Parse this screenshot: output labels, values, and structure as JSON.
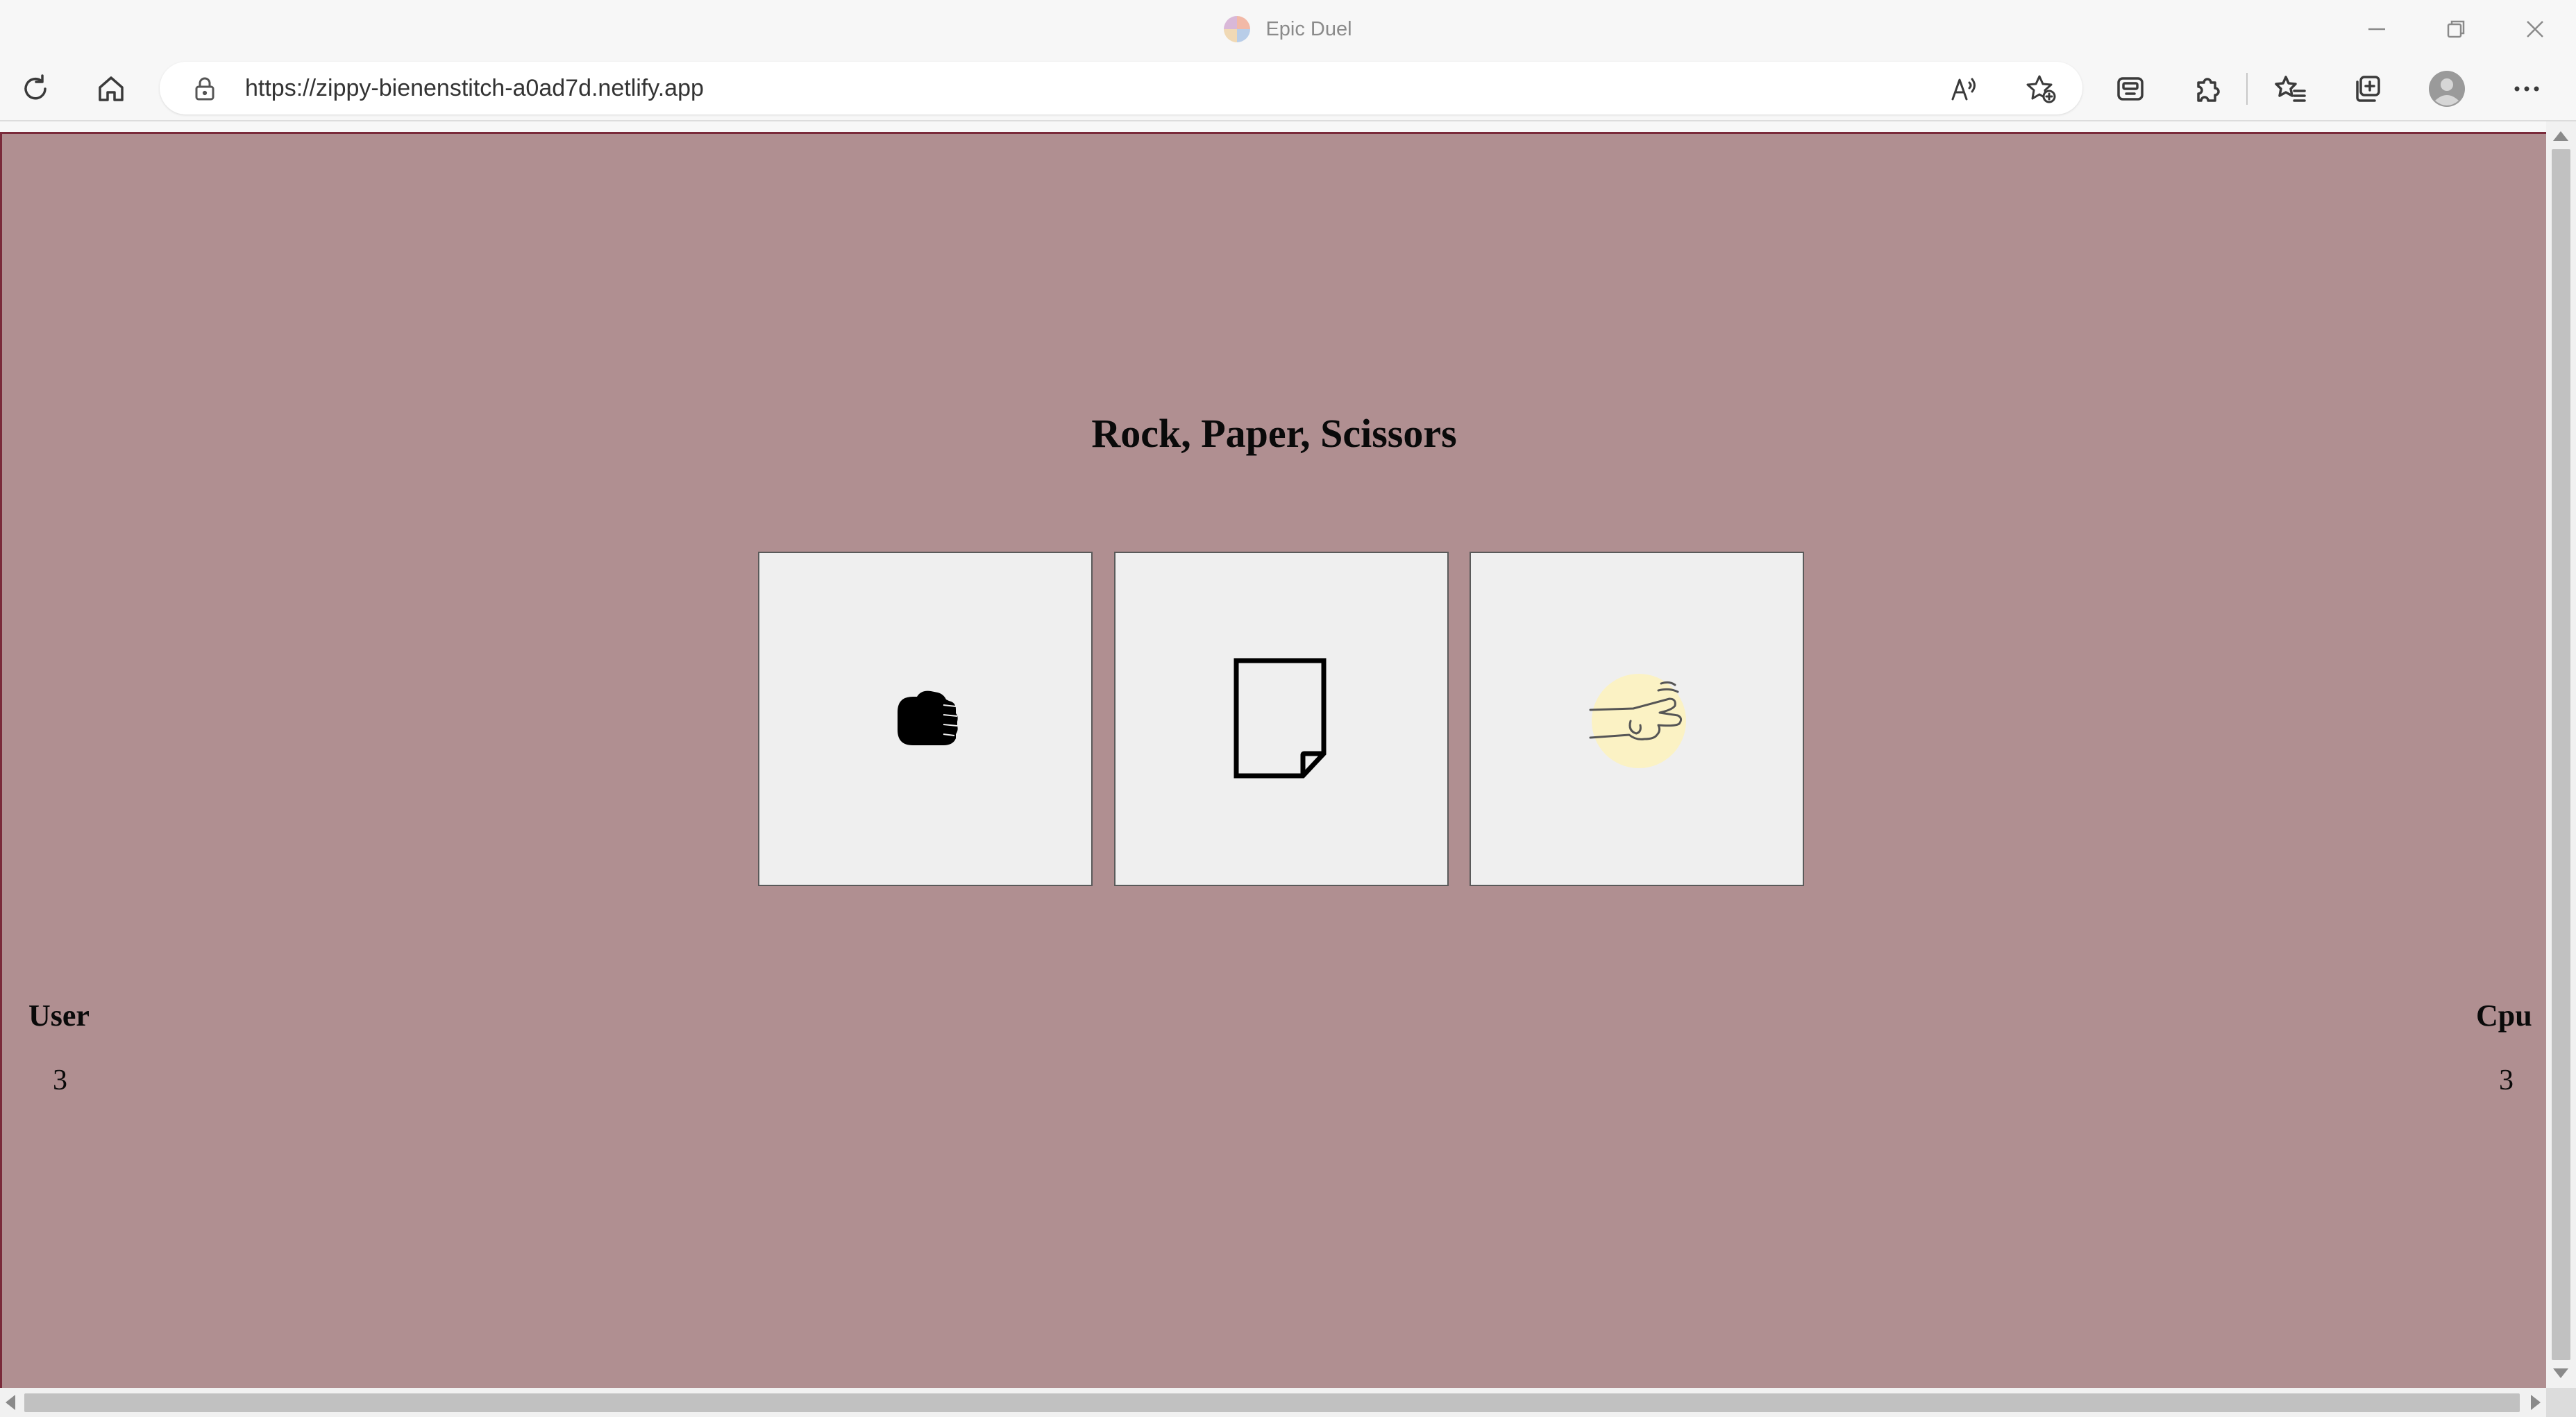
{
  "window": {
    "title": "Epic Duel",
    "controls": [
      "minimize-icon",
      "restore-icon",
      "close-icon"
    ]
  },
  "toolbar": {
    "url": "https://zippy-bienenstitch-a0ad7d.netlify.app",
    "icons": [
      "refresh-icon",
      "home-icon",
      "lock-icon",
      "read-aloud-icon",
      "add-favorite-icon",
      "copilot-icon",
      "extensions-icon",
      "favorites-icon",
      "collections-icon",
      "profile-icon",
      "more-icon"
    ]
  },
  "game": {
    "title": "Rock, Paper, Scissors",
    "choices": [
      {
        "name": "rock",
        "icon": "fist-icon"
      },
      {
        "name": "paper",
        "icon": "paper-icon"
      },
      {
        "name": "scissors",
        "icon": "scissors-hand-icon"
      }
    ]
  },
  "score": {
    "user_label": "User",
    "user_value": "3",
    "cpu_label": "Cpu",
    "cpu_value": "3"
  },
  "colors": {
    "page_background": "#b08f91",
    "page_border": "#7a2a3a",
    "choice_background": "#efefef",
    "scissors_halo": "#fbf2c4",
    "browser_chrome": "#f7f7f7"
  }
}
